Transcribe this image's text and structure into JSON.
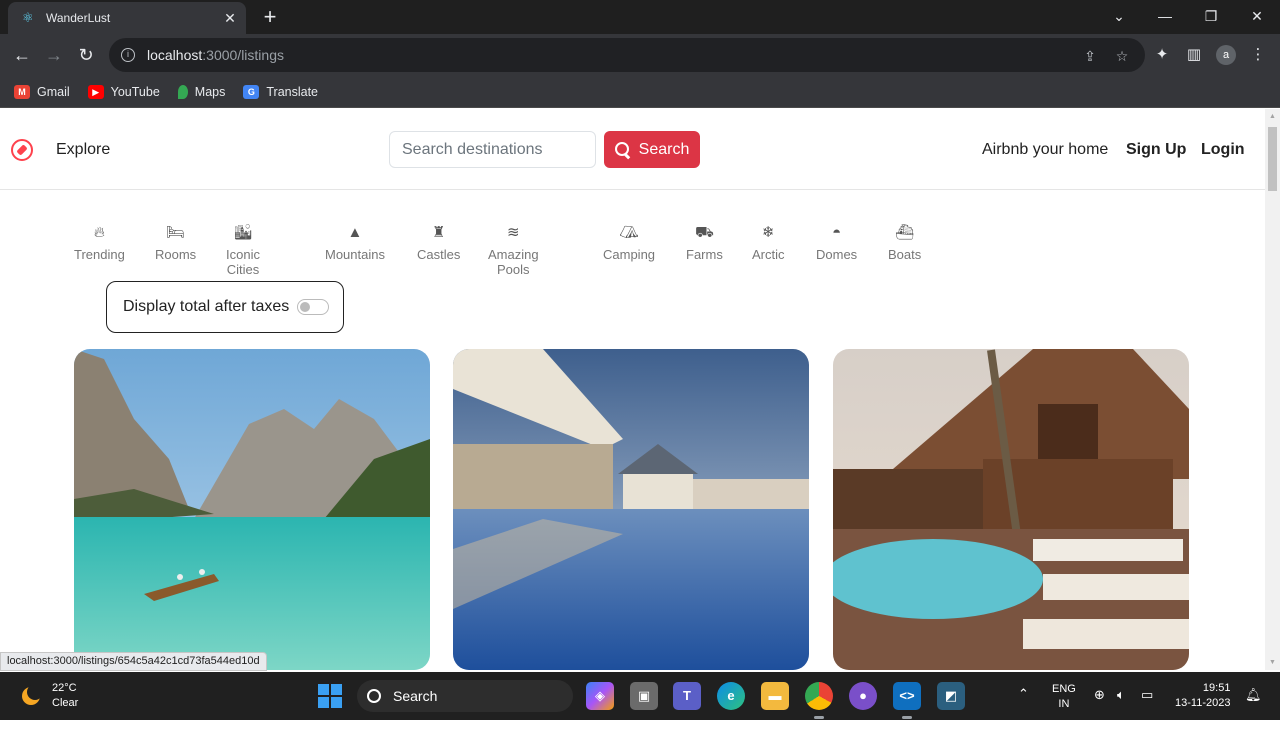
{
  "browser": {
    "tab_title": "WanderLust",
    "url_host": "localhost",
    "url_path": ":3000/listings",
    "bookmarks": [
      {
        "label": "Gmail",
        "icon": "gmail-icon",
        "color": "#ea4335"
      },
      {
        "label": "YouTube",
        "icon": "youtube-icon",
        "color": "#ff0000"
      },
      {
        "label": "Maps",
        "icon": "maps-icon",
        "color": "#34a853"
      },
      {
        "label": "Translate",
        "icon": "translate-icon",
        "color": "#4285f4"
      }
    ],
    "profile_initial": "a",
    "status_url": "localhost:3000/listings/654c5a42c1cd73fa544ed10d"
  },
  "navbar": {
    "explore": "Explore",
    "search_placeholder": "Search destinations",
    "search_button": "Search",
    "airbnb_home": "Airbnb your home",
    "signup": "Sign Up",
    "login": "Login",
    "brand_color": "#fe424d"
  },
  "filters": [
    {
      "label": "Trending",
      "icon": "fire-icon"
    },
    {
      "label": "Rooms",
      "icon": "bed-icon"
    },
    {
      "label": "Iconic Cities",
      "icon": "city-icon"
    },
    {
      "label": "Mountains",
      "icon": "mountain-icon"
    },
    {
      "label": "Castles",
      "icon": "castle-icon"
    },
    {
      "label": "Amazing Pools",
      "icon": "pool-icon"
    },
    {
      "label": "Camping",
      "icon": "tent-icon"
    },
    {
      "label": "Farms",
      "icon": "tractor-icon"
    },
    {
      "label": "Arctic",
      "icon": "snowflake-icon"
    },
    {
      "label": "Domes",
      "icon": "igloo-icon"
    },
    {
      "label": "Boats",
      "icon": "ship-icon"
    }
  ],
  "tax_toggle": {
    "label": "Display total after taxes",
    "checked": false
  },
  "listings": [
    {
      "image": "mountain-lake-image"
    },
    {
      "image": "resort-pool-image"
    },
    {
      "image": "beach-lodge-image"
    }
  ],
  "taskbar": {
    "weather_temp": "22°C",
    "weather_desc": "Clear",
    "search_label": "Search",
    "lang_top": "ENG",
    "lang_bottom": "IN",
    "time": "19:51",
    "date": "13-11-2023"
  }
}
